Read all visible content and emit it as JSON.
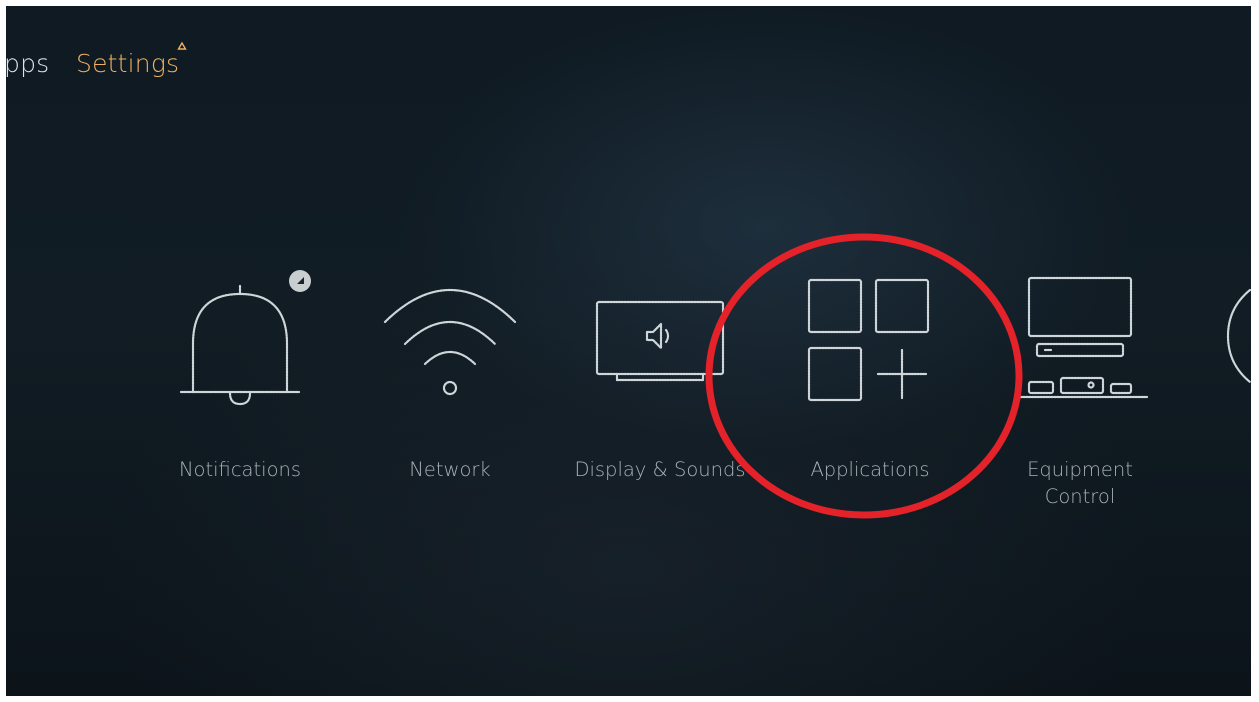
{
  "nav": {
    "apps_partial": "pps",
    "settings_label": "Settings"
  },
  "tiles": [
    {
      "label": "Notifications",
      "icon": "bell-icon"
    },
    {
      "label": "Network",
      "icon": "wifi-icon"
    },
    {
      "label": "Display & Sounds",
      "icon": "display-sound-icon"
    },
    {
      "label": "Applications",
      "icon": "applications-icon"
    },
    {
      "label": "Equipment\nControl",
      "icon": "equipment-control-icon"
    }
  ],
  "colors": {
    "background": "#0f1a22",
    "nav_active": "#f0b161",
    "label": "#a9b2b8",
    "highlight_circle": "#e3222a"
  }
}
